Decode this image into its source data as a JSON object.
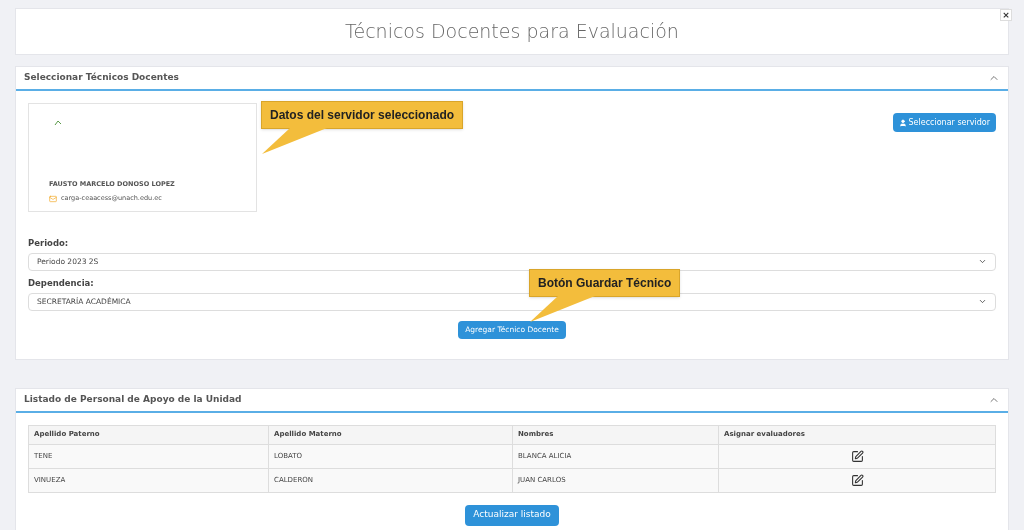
{
  "page_title": "Técnicos Docentes para Evaluación",
  "close_label": "×",
  "select_panel": {
    "title": "Seleccionar Técnicos Docentes",
    "expanded": true,
    "server": {
      "name": "FAUSTO MARCELO DONOSO LOPEZ",
      "email": "carga-ceaacess@unach.edu.ec"
    },
    "select_button": "Seleccionar servidor",
    "fields": [
      {
        "label": "Periodo:",
        "value": "Periodo 2023 2S"
      },
      {
        "label": "Dependencia:",
        "value": "SECRETARÍA ACADÉMICA"
      }
    ],
    "add_button": "Agregar Técnico Docente",
    "callouts": [
      "Datos del servidor seleccionado",
      "Botón Guardar Técnico"
    ]
  },
  "list_panel": {
    "title": "Listado de Personal de Apoyo de la Unidad",
    "expanded": true,
    "columns": [
      "Apellido Paterno",
      "Apellido Materno",
      "Nombres",
      "Asignar evaluadores"
    ],
    "rows": [
      [
        "TENE",
        "LOBATO",
        "BLANCA ALICIA"
      ],
      [
        "VINUEZA",
        "CALDERON",
        "JUAN CARLOS"
      ]
    ],
    "refresh_button": "Actualizar listado"
  }
}
